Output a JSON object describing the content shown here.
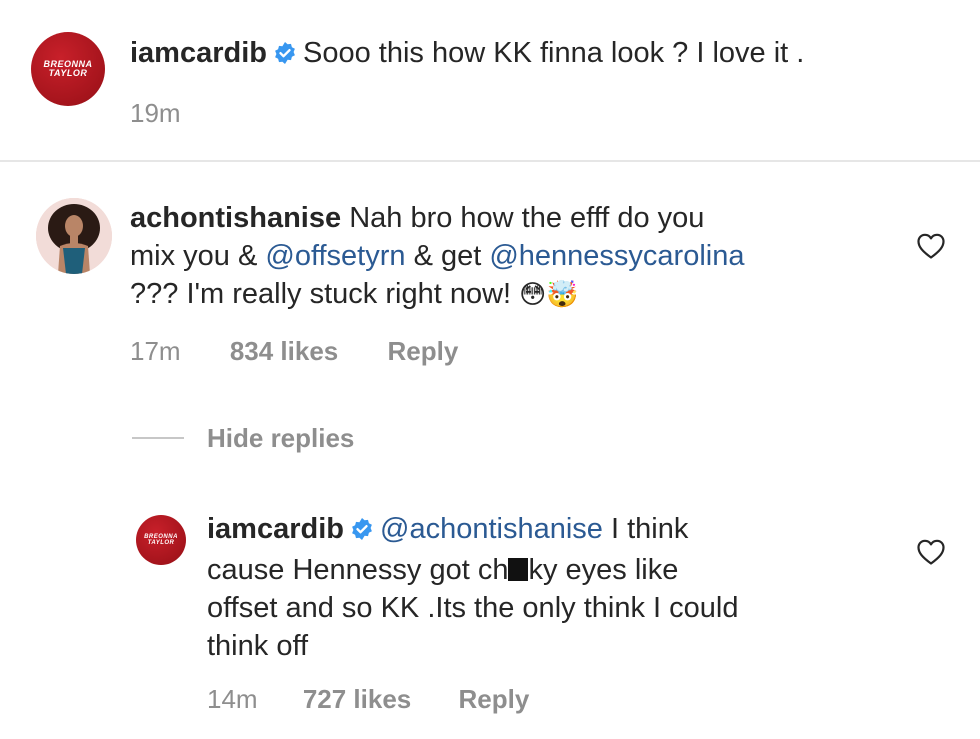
{
  "post": {
    "avatar_text_line1": "BREONNA",
    "avatar_text_line2": "TAYLOR",
    "username": "iamcardib",
    "caption": "Sooo this how KK finna look ? I love it .",
    "time": "19m"
  },
  "comments": [
    {
      "username": "achontishanise",
      "line1": "Nah bro how the efff do you",
      "line2_prefix": "mix you & ",
      "line2_mention1": "@offsetyrn",
      "line2_mid": " & get ",
      "line2_mention2": "@hennessycarolina",
      "line3": "??? I'm really stuck right now!",
      "emoji": "😳🤯",
      "time": "17m",
      "likes": "834 likes",
      "reply": "Reply",
      "hide_replies": "Hide replies"
    },
    {
      "avatar_text_line1": "BREONNA",
      "avatar_text_line2": "TAYLOR",
      "username": "iamcardib",
      "mention": "@achontishanise",
      "line1_suffix": " I think",
      "line2_prefix": "cause Hennessy got ch",
      "line2_suffix": "ky eyes like",
      "line3": "offset and so KK .Its the only think I could",
      "line4": "think off",
      "time": "14m",
      "likes": "727 likes",
      "reply": "Reply"
    }
  ],
  "icons": {
    "verified": "verified-badge-icon",
    "heart": "heart-outline-icon"
  },
  "colors": {
    "mention": "#2b5a93",
    "verified": "#3897f0",
    "meta": "#8e8e8e"
  }
}
